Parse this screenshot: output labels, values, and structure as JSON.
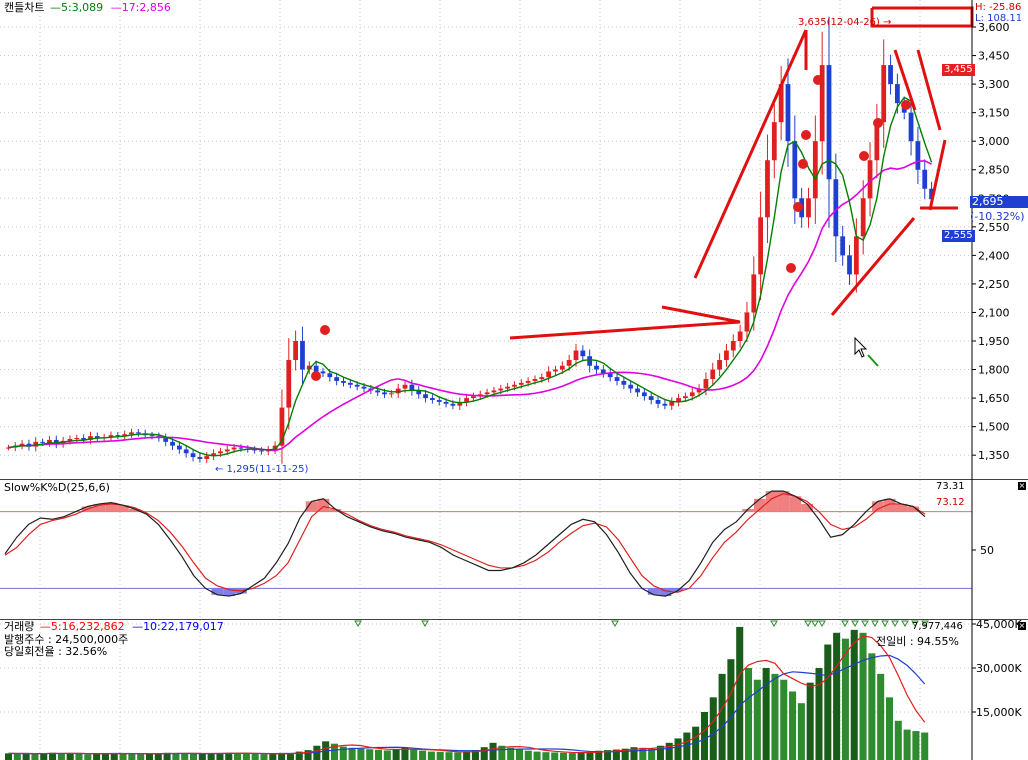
{
  "chart_data": [
    {
      "type": "candlestick",
      "title": "캔들차트",
      "ma_legend": [
        {
          "label": "5:3,089",
          "color": "#008000"
        },
        {
          "label": "17:2,856",
          "color": "#e000e0"
        }
      ],
      "yaxis_ticks": [
        "3,600",
        "3,450",
        "3,300",
        "3,150",
        "3,000",
        "2,850",
        "2,700",
        "2,550",
        "2,400",
        "2,250",
        "2,100",
        "1,950",
        "1,800",
        "1,650",
        "1,500",
        "1,350"
      ],
      "ylim": [
        1230,
        3700
      ],
      "grid": true,
      "annotations": {
        "high_marker": "3,635(12-04-26) →",
        "low_marker": "← 1,295(11-11-25)",
        "top_right_h": "H: -25.86",
        "top_right_l": "L: 108.11",
        "price_box_red": "3,455",
        "price_box_current": "2,695",
        "price_box_change": "(-10.32%)",
        "price_box_blue": "2,555"
      },
      "close": [
        1390,
        1400,
        1410,
        1395,
        1420,
        1415,
        1430,
        1410,
        1425,
        1435,
        1440,
        1430,
        1450,
        1440,
        1445,
        1455,
        1450,
        1460,
        1470,
        1465,
        1455,
        1450,
        1440,
        1420,
        1400,
        1380,
        1360,
        1340,
        1330,
        1345,
        1360,
        1370,
        1380,
        1390,
        1385,
        1380,
        1375,
        1370,
        1380,
        1400,
        1600,
        1850,
        1950,
        1800,
        1820,
        1790,
        1780,
        1760,
        1740,
        1730,
        1720,
        1710,
        1700,
        1690,
        1680,
        1670,
        1675,
        1700,
        1720,
        1690,
        1670,
        1650,
        1640,
        1630,
        1620,
        1610,
        1630,
        1650,
        1660,
        1670,
        1680,
        1690,
        1700,
        1710,
        1720,
        1730,
        1740,
        1750,
        1760,
        1790,
        1800,
        1820,
        1850,
        1900,
        1870,
        1820,
        1800,
        1780,
        1760,
        1740,
        1720,
        1700,
        1680,
        1660,
        1640,
        1620,
        1610,
        1630,
        1650,
        1660,
        1680,
        1700,
        1750,
        1800,
        1850,
        1900,
        1950,
        2000,
        2100,
        2300,
        2600,
        2900,
        3100,
        3300,
        3000,
        2700,
        2600,
        2700,
        3000,
        3400,
        2800,
        2500,
        2400,
        2300,
        2500,
        2700,
        2900,
        3100,
        3400,
        3300,
        3200,
        3150,
        3000,
        2850,
        2750,
        2695
      ]
    },
    {
      "type": "line",
      "title": "Slow%K%D(25,6,6)",
      "values": {
        "k_last": "73.31",
        "d_last": "73.12"
      },
      "yaxis_ticks": [
        "50"
      ],
      "ylim": [
        0,
        100
      ],
      "k": [
        47,
        60,
        70,
        75,
        74,
        76,
        80,
        84,
        86,
        87,
        85,
        82,
        78,
        70,
        58,
        45,
        30,
        20,
        15,
        14,
        16,
        22,
        28,
        40,
        55,
        75,
        88,
        90,
        82,
        76,
        72,
        68,
        65,
        63,
        60,
        58,
        56,
        52,
        46,
        42,
        38,
        34,
        34,
        36,
        40,
        46,
        54,
        62,
        70,
        74,
        72,
        62,
        48,
        32,
        20,
        15,
        14,
        18,
        26,
        40,
        56,
        66,
        72,
        82,
        90,
        96,
        96,
        92,
        86,
        74,
        60,
        62,
        70,
        80,
        88,
        90,
        86,
        84,
        76
      ],
      "d": [
        46,
        52,
        62,
        70,
        73,
        75,
        78,
        82,
        85,
        86,
        85,
        83,
        79,
        73,
        64,
        53,
        40,
        28,
        22,
        19,
        18,
        20,
        24,
        30,
        40,
        58,
        76,
        84,
        82,
        78,
        73,
        69,
        66,
        64,
        61,
        59,
        57,
        54,
        50,
        46,
        42,
        38,
        36,
        36,
        38,
        42,
        48,
        56,
        63,
        69,
        71,
        68,
        58,
        44,
        30,
        22,
        18,
        17,
        20,
        30,
        44,
        56,
        64,
        74,
        82,
        90,
        94,
        92,
        88,
        80,
        70,
        66,
        68,
        74,
        82,
        86,
        86,
        84,
        78
      ]
    },
    {
      "type": "bar",
      "title": "거래량",
      "legend": [
        {
          "label": "5:16,232,862",
          "color": "#ff0000"
        },
        {
          "label": "10:22,179,017",
          "color": "#0000ff"
        }
      ],
      "info_lines": [
        "발행주수 : 24,500,000주",
        "당일회전율 : 32.56%"
      ],
      "last_volume": "7,977,446",
      "prev_ratio": "전일비 : 94.55%",
      "yaxis_ticks": [
        "45,000K",
        "30,000K",
        "15,000K"
      ],
      "ylim": [
        0,
        45000
      ],
      "values": [
        900,
        800,
        850,
        700,
        900,
        1100,
        800,
        950,
        700,
        600,
        800,
        900,
        1000,
        750,
        700,
        650,
        800,
        900,
        1100,
        950,
        850,
        700,
        800,
        900,
        1000,
        1100,
        900,
        800,
        700,
        650,
        800,
        900,
        1000,
        1500,
        2000,
        3500,
        5000,
        4200,
        3200,
        2800,
        2500,
        2300,
        2100,
        1900,
        2400,
        2800,
        2200,
        1800,
        1500,
        1400,
        1300,
        1200,
        1500,
        2000,
        3000,
        4500,
        3500,
        2800,
        2200,
        1800,
        1500,
        1300,
        1200,
        1100,
        1000,
        1200,
        1400,
        1800,
        2000,
        2200,
        2500,
        3000,
        2800,
        2500,
        3500,
        4500,
        6000,
        8000,
        10000,
        15000,
        20000,
        28000,
        33000,
        44000,
        30000,
        26000,
        30000,
        28000,
        26000,
        22000,
        18000,
        25000,
        30000,
        38000,
        42000,
        40000,
        43000,
        42000,
        35000,
        28000,
        20000,
        12000,
        9000,
        8500,
        8000
      ]
    }
  ]
}
